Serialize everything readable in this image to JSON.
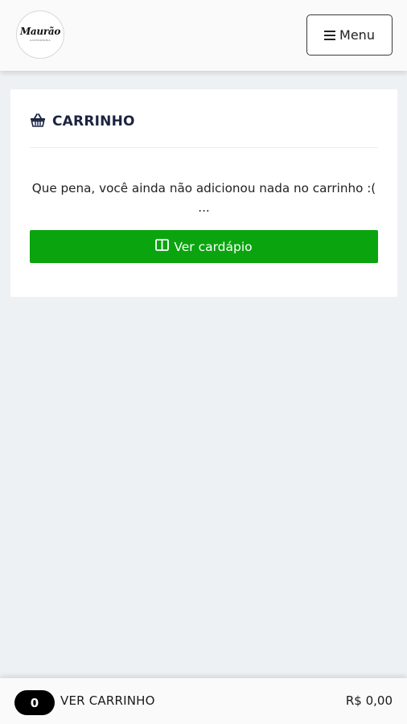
{
  "header": {
    "logo_text": "Maurão",
    "logo_subtext": "GASTRONOMIA",
    "menu_label": "Menu"
  },
  "cart": {
    "title": "CARRINHO",
    "empty_message": "Que pena, você ainda não adicionou nada no carrinho :( ...",
    "cta_label": "Ver cardápio"
  },
  "footer": {
    "count": "0",
    "label": "VER CARRINHO",
    "total": "R$ 0,00"
  },
  "colors": {
    "primary_green": "#0aa40f",
    "background": "#eef1f4",
    "title_navy": "#1b2440"
  },
  "icons": {
    "menu": "hamburger-icon",
    "cart": "basket-icon",
    "cta": "book-open-icon"
  }
}
